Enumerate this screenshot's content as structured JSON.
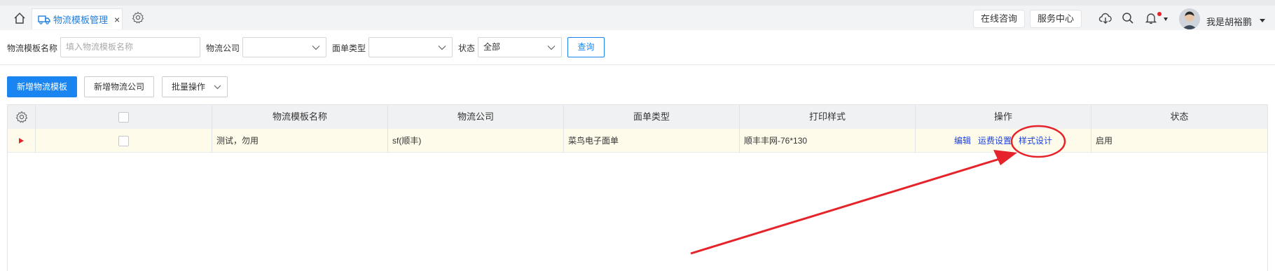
{
  "topbar": {
    "tab_label": "物流模板管理",
    "tab_close": "×",
    "online_consult": "在线咨询",
    "service_center": "服务中心",
    "user_name": "我是胡裕鹏",
    "icons": [
      "home-icon",
      "truck-icon",
      "close-icon",
      "gear-icon",
      "cloud-download-icon",
      "search-icon",
      "bell-icon",
      "avatar",
      "caret-down-icon"
    ]
  },
  "filters": {
    "template_name_label": "物流模板名称",
    "template_name_placeholder": "填入物流模板名称",
    "company_label": "物流公司",
    "company_value": "",
    "sheet_type_label": "面单类型",
    "sheet_type_value": "",
    "status_label": "状态",
    "status_value": "全部",
    "query_button": "查询"
  },
  "actions": {
    "add_template": "新增物流模板",
    "add_company": "新增物流公司",
    "batch_ops": "批量操作"
  },
  "table": {
    "columns": [
      "物流模板名称",
      "物流公司",
      "面单类型",
      "打印样式",
      "操作",
      "状态"
    ],
    "rows": [
      {
        "template_name": "测试，勿用",
        "company": "sf(顺丰)",
        "sheet_type": "菜鸟电子面单",
        "print_style": "顺丰丰网-76*130",
        "ops": [
          "编辑",
          "运费设置",
          "样式设计"
        ],
        "status": "启用"
      }
    ]
  },
  "colors": {
    "primary": "#1a85f0",
    "link": "#1a3fe0",
    "annotation_red": "#e6232a",
    "row_highlight": "#fffbea"
  }
}
